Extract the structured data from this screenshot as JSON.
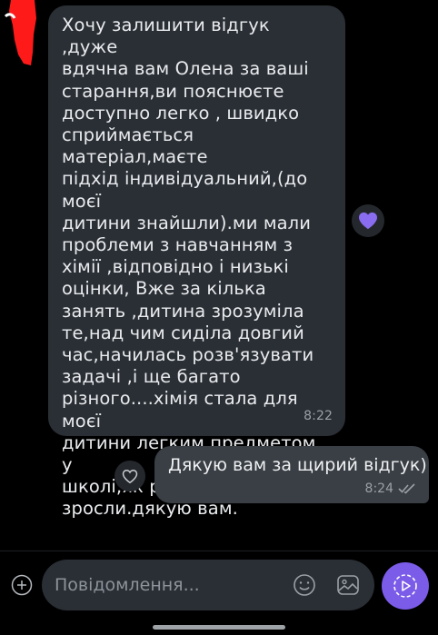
{
  "colors": {
    "background": "#000000",
    "incoming_bubble": "#2a2f35",
    "outgoing_bubble": "#3a3f45",
    "accent": "#7b5ce8",
    "reaction_heart": "#8a6cf0",
    "redaction_mark": "#ff1a1a"
  },
  "messages": {
    "incoming": {
      "text": "Хочу залишити відгук ,дуже\nвдячна вам Олена за ваші\nстарання,ви пояснюєте\nдоступно легко , швидко\nсприймається матеріал,маєте\nпідхід індивідуальний,(до моєї\nдитини знайшли).ми мали\nпроблеми з навчанням з\nхімії ,відповідно і низькі\nоцінки, Вже за кілька\nзанять ,дитина зрозуміла\nте,над чим сиділа довгий\nчас,начилась розв'язувати\nзадачі ,і ще багато\nрізного....хімія стала для моєї\nдитини легким предметом у\nшколі,як результат оцінки\nзросли.дякую вам.",
      "time": "8:22",
      "reaction_icon": "purple-heart-icon"
    },
    "outgoing": {
      "text": "Дякую вам за щирий відгук)",
      "time": "8:24",
      "status_icon": "double-check-icon",
      "like_icon": "heart-outline-icon"
    }
  },
  "composer": {
    "placeholder": "Повідомлення...",
    "add_icon": "plus-circle-icon",
    "emoji_icon": "smiley-icon",
    "gallery_icon": "gallery-icon",
    "send_icon": "send-icon"
  }
}
